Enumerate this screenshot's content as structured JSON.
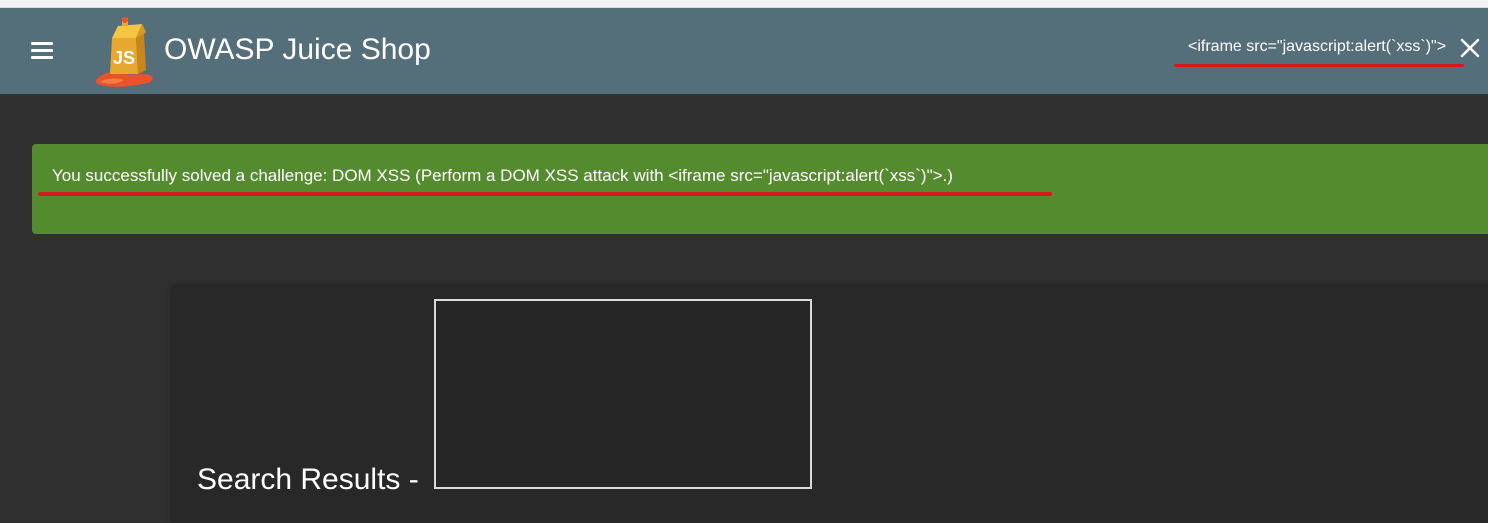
{
  "header": {
    "title": "OWASP Juice Shop",
    "logo_text": "JS",
    "menu_icon": "menu-icon",
    "close_icon": "close-icon"
  },
  "search": {
    "value": "<iframe src=\"javascript:alert(`xss`)\">"
  },
  "snackbar": {
    "message": "You successfully solved a challenge: DOM XSS (Perform a DOM XSS attack with <iframe src=\"javascript:alert(`xss`)\">.)",
    "color": "#558b2f"
  },
  "results": {
    "heading": "Search Results -"
  },
  "colors": {
    "toolbar": "#546e7a",
    "background": "#303030",
    "card": "#282828",
    "highlight": "#d21a1a"
  }
}
